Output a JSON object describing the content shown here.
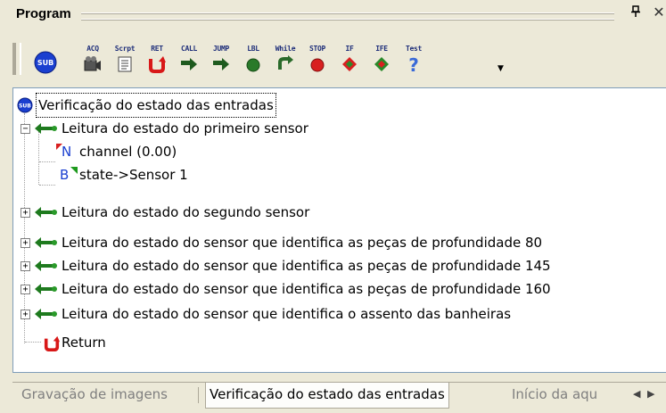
{
  "panel": {
    "title": "Program"
  },
  "toolbar": {
    "buttons": [
      {
        "caption": "",
        "icon": "sub-icon"
      },
      {
        "caption": "ACQ",
        "icon": "camera-icon"
      },
      {
        "caption": "Scrpt",
        "icon": "script-icon"
      },
      {
        "caption": "RET",
        "icon": "return-icon"
      },
      {
        "caption": "CALL",
        "icon": "call-icon"
      },
      {
        "caption": "JUMP",
        "icon": "jump-icon"
      },
      {
        "caption": "LBL",
        "icon": "label-icon"
      },
      {
        "caption": "While",
        "icon": "while-icon"
      },
      {
        "caption": "STOP",
        "icon": "stop-icon"
      },
      {
        "caption": "IF",
        "icon": "if-icon"
      },
      {
        "caption": "IFE",
        "icon": "ife-icon"
      },
      {
        "caption": "Test",
        "icon": "test-icon"
      }
    ]
  },
  "tree": {
    "root": "Verificação do estado das entradas",
    "items": [
      {
        "label": "Leitura do estado do primeiro sensor",
        "expanded": true,
        "children": [
          "channel (0.00)",
          "state->Sensor 1"
        ]
      },
      {
        "label": "Leitura do estado do segundo sensor",
        "expanded": false
      },
      {
        "label": "Leitura do estado do sensor que identifica as peças de profundidade 80",
        "expanded": false
      },
      {
        "label": "Leitura do estado do sensor que identifica as peças de profundidade 145",
        "expanded": false
      },
      {
        "label": "Leitura do estado do sensor que identifica as peças de profundidade 160",
        "expanded": false
      },
      {
        "label": "Leitura do estado do sensor que identifica o assento das banheiras",
        "expanded": false
      }
    ],
    "return_label": "Return",
    "child_markers": [
      "N",
      "B"
    ]
  },
  "tabs": [
    {
      "label": "Gravação de imagens",
      "active": false
    },
    {
      "label": "Verificação do estado das entradas",
      "active": true
    },
    {
      "label": "Início da aqu",
      "active": false
    }
  ],
  "colors": {
    "call_arrow": "#1e7a1e",
    "sub_badge": "#1a3fd0",
    "return_icon": "#d81818"
  }
}
